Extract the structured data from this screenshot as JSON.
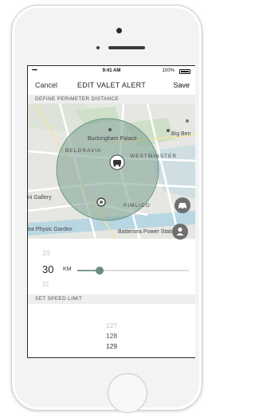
{
  "status_bar": {
    "signal": "•••• ",
    "time": "9:41 AM",
    "battery": "100%"
  },
  "nav": {
    "cancel": "Cancel",
    "title": "EDIT VALET ALERT",
    "save": "Save"
  },
  "perimeter_section": {
    "header": "DEFINE PERIMETER DISTANCE"
  },
  "map": {
    "labels": {
      "buckingham": "Buckingham Palace",
      "big_ben": "Big Ben",
      "belgravia": "BELGRAVIA",
      "westminster": "WESTMINSTER",
      "gallery": "ni Gallery",
      "pimlico": "PIMLICO",
      "physic_garden": "ea Physic Garden",
      "battersea": "Battersea Power Station"
    },
    "colors": {
      "land": "#e6e7e3",
      "park": "#cfe0c8",
      "water": "#b9d7e3",
      "radius": "#7fa494"
    }
  },
  "distance_picker": {
    "prev": "29",
    "value": "30",
    "unit": "KM",
    "next": "31",
    "slider_fraction": 0.2
  },
  "speed_section": {
    "header": "SET SPEED LIMIT",
    "values": [
      "127",
      "128",
      "129"
    ]
  },
  "icons": {
    "car_fab": "car-icon",
    "person_fab": "person-icon",
    "vehicle_marker": "car-marker-icon"
  }
}
